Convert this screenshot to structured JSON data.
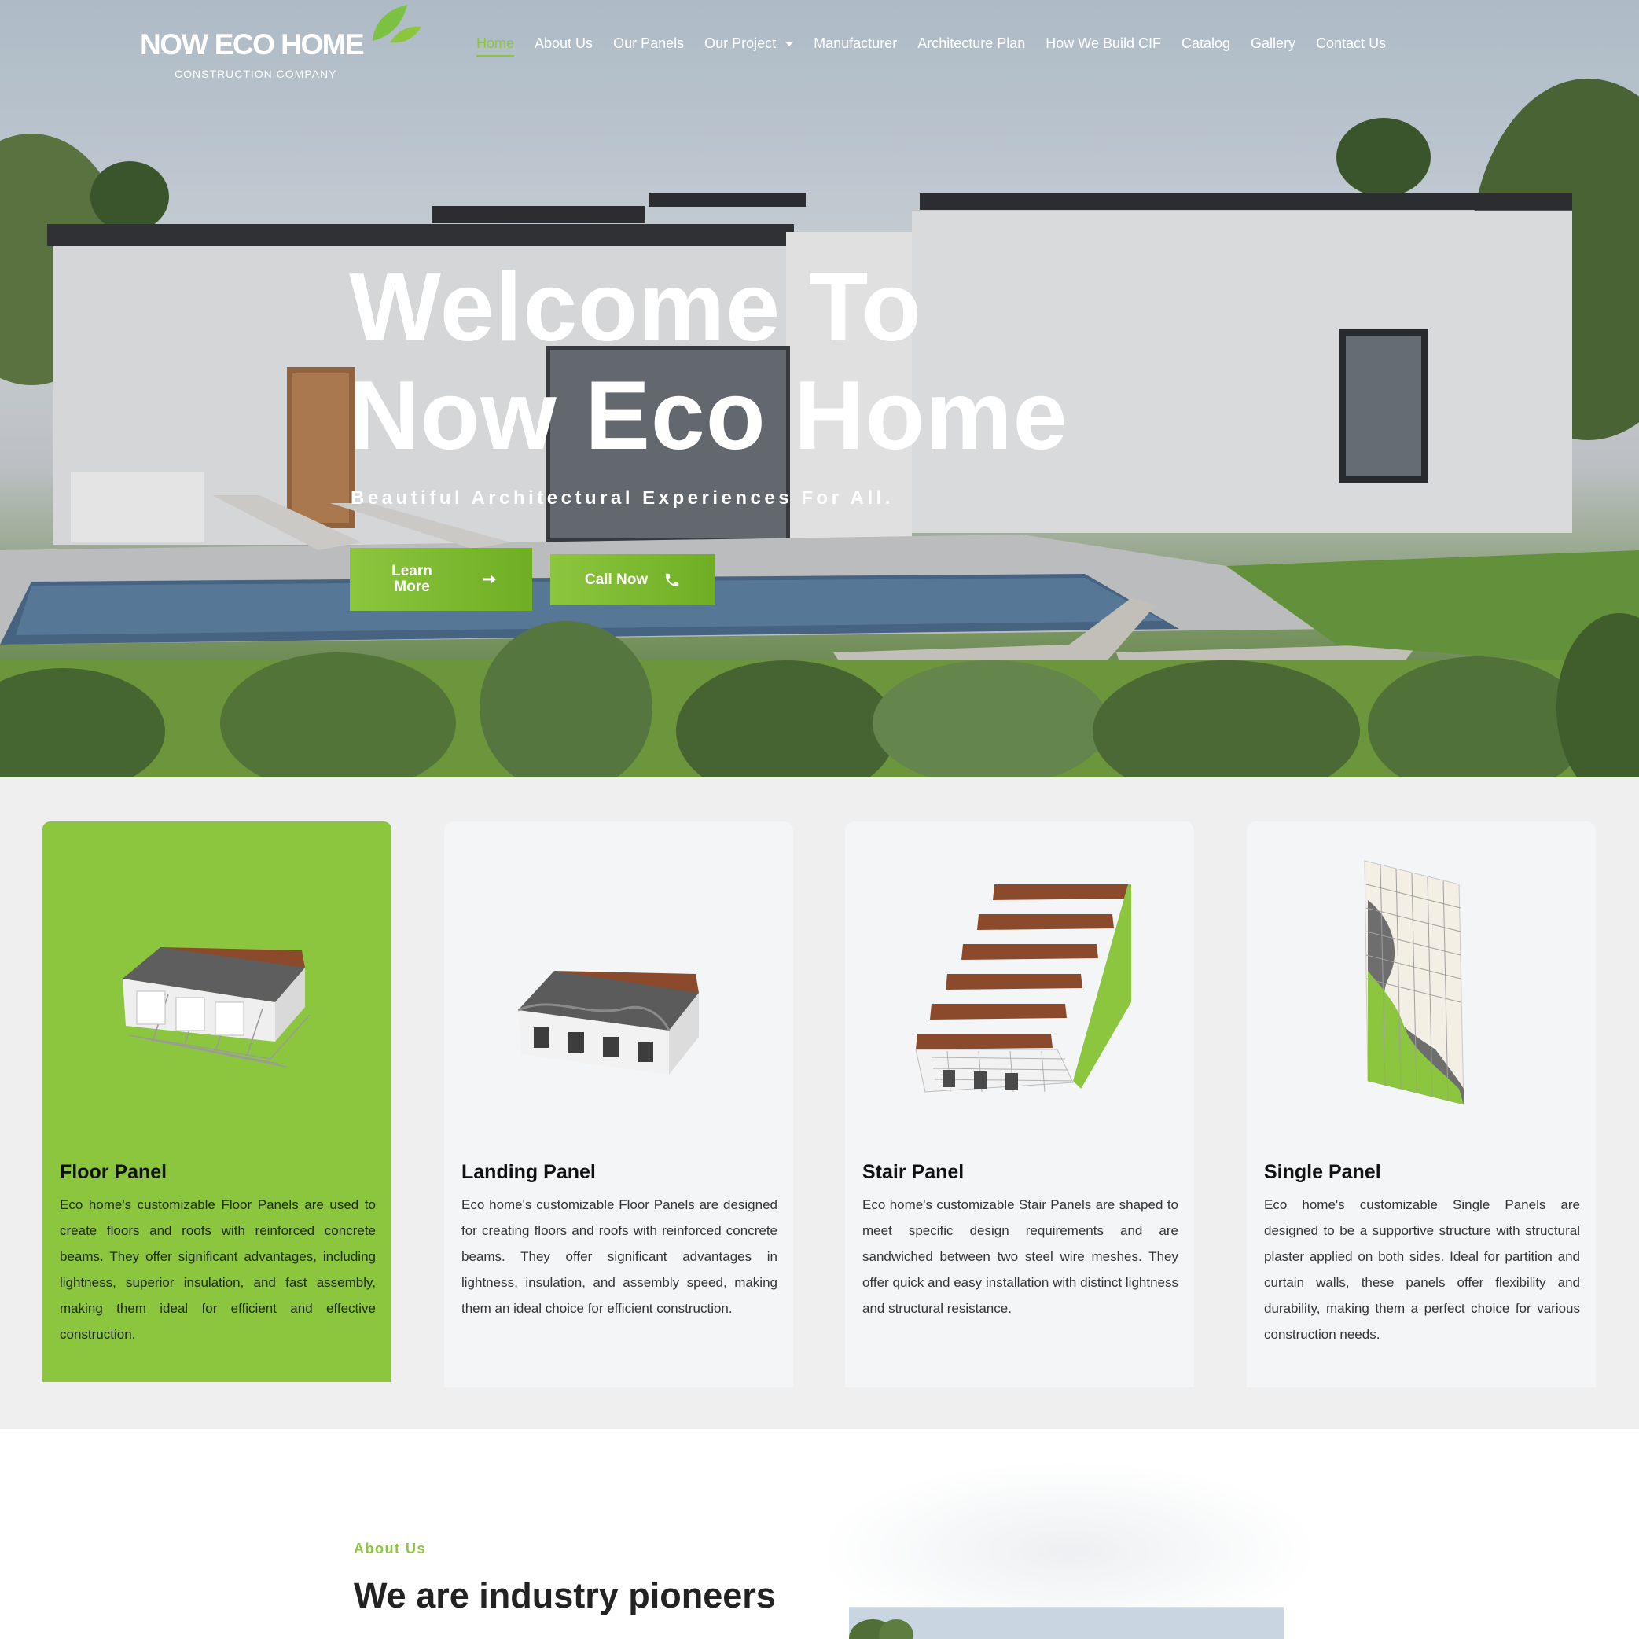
{
  "brand": {
    "name": "NOW ECO HOME",
    "tagline": "CONSTRUCTION COMPANY"
  },
  "nav": {
    "items": [
      {
        "label": "Home",
        "active": true
      },
      {
        "label": "About Us"
      },
      {
        "label": "Our Panels"
      },
      {
        "label": "Our Project",
        "has_dropdown": true
      },
      {
        "label": "Manufacturer"
      },
      {
        "label": "Architecture Plan"
      },
      {
        "label": "How We Build CIF"
      },
      {
        "label": "Catalog"
      },
      {
        "label": "Gallery"
      },
      {
        "label": "Contact Us"
      }
    ]
  },
  "hero": {
    "title_line1": "Welcome To",
    "title_line2": "Now Eco Home",
    "subtitle": "Beautiful Architectural Experiences For All.",
    "learn_more_line1": "Learn",
    "learn_more_line2": "More",
    "learn_more_icon": "arrow-right-icon",
    "call_now": "Call Now",
    "call_now_icon": "phone-icon"
  },
  "panels": [
    {
      "title": "Floor Panel",
      "description": "Eco home's customizable Floor Panels are used to create floors and roofs with reinforced concrete beams. They offer significant advantages, including lightness, superior insulation, and fast assembly, making them ideal for efficient and effective construction.",
      "featured": true
    },
    {
      "title": "Landing Panel",
      "description": "Eco home's customizable Floor Panels are designed for creating floors and roofs with reinforced concrete beams. They offer significant advantages in lightness, insulation, and assembly speed, making them an ideal choice for efficient construction."
    },
    {
      "title": "Stair Panel",
      "description": "Eco home's customizable Stair Panels are shaped to meet specific design requirements and are sandwiched between two steel wire meshes. They offer quick and easy installation with distinct lightness and structural resistance."
    },
    {
      "title": "Single Panel",
      "description": "Eco home's customizable Single Panels are designed to be a supportive structure with structural plaster applied on both sides. Ideal for partition and curtain walls, these panels offer flexibility and durability, making them a perfect choice for various construction needs."
    }
  ],
  "about": {
    "eyebrow": "About Us",
    "heading": "We are industry pioneers"
  },
  "colors": {
    "accent": "#8cc63f",
    "accent_dark": "#6fae22",
    "section_bg": "#efefef",
    "card_bg": "#f4f5f7"
  }
}
